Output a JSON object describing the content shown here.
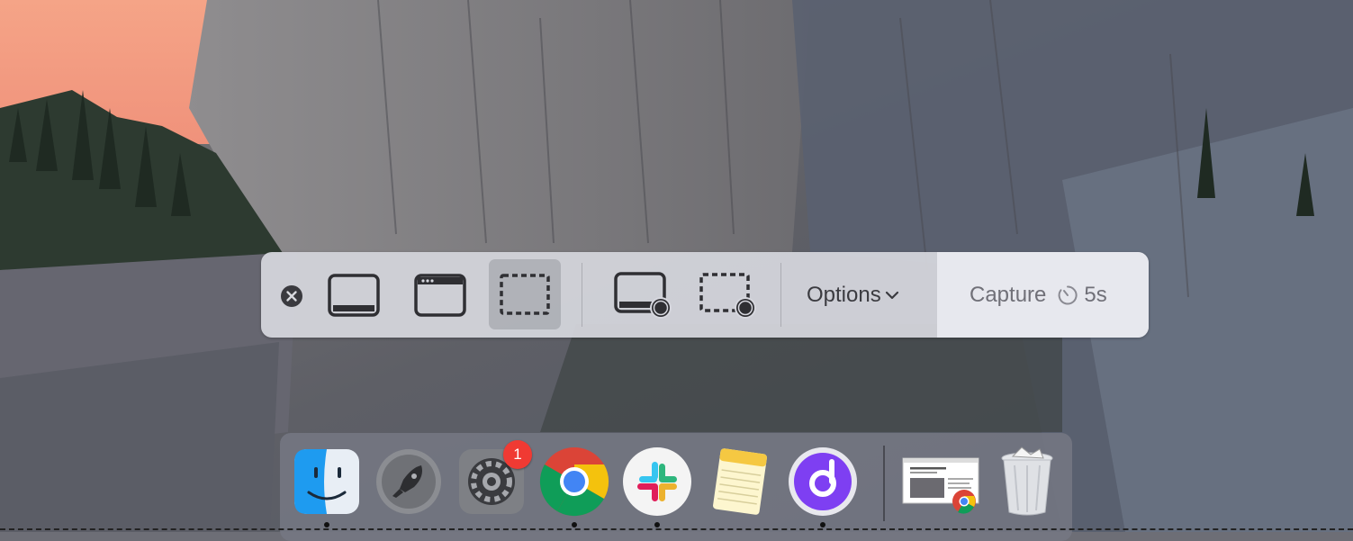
{
  "screenshot_toolbar": {
    "options_label": "Options",
    "capture_label": "Capture",
    "timer_label": "5s"
  },
  "dock": {
    "apps": [
      {
        "name": "finder-icon",
        "running": true
      },
      {
        "name": "launchpad-icon",
        "running": false
      },
      {
        "name": "system-preferences-icon",
        "running": false,
        "badge": "1"
      },
      {
        "name": "chrome-icon",
        "running": true
      },
      {
        "name": "slack-icon",
        "running": true
      },
      {
        "name": "notes-icon",
        "running": false
      },
      {
        "name": "purple-app-icon",
        "running": true
      },
      {
        "name": "chrome-window-thumbnail-icon",
        "running": false
      },
      {
        "name": "trash-icon",
        "running": false
      }
    ]
  },
  "colors": {
    "sky_peach": "#f3a487",
    "capture_text": "#707078",
    "badge_red": "#f03a33"
  }
}
